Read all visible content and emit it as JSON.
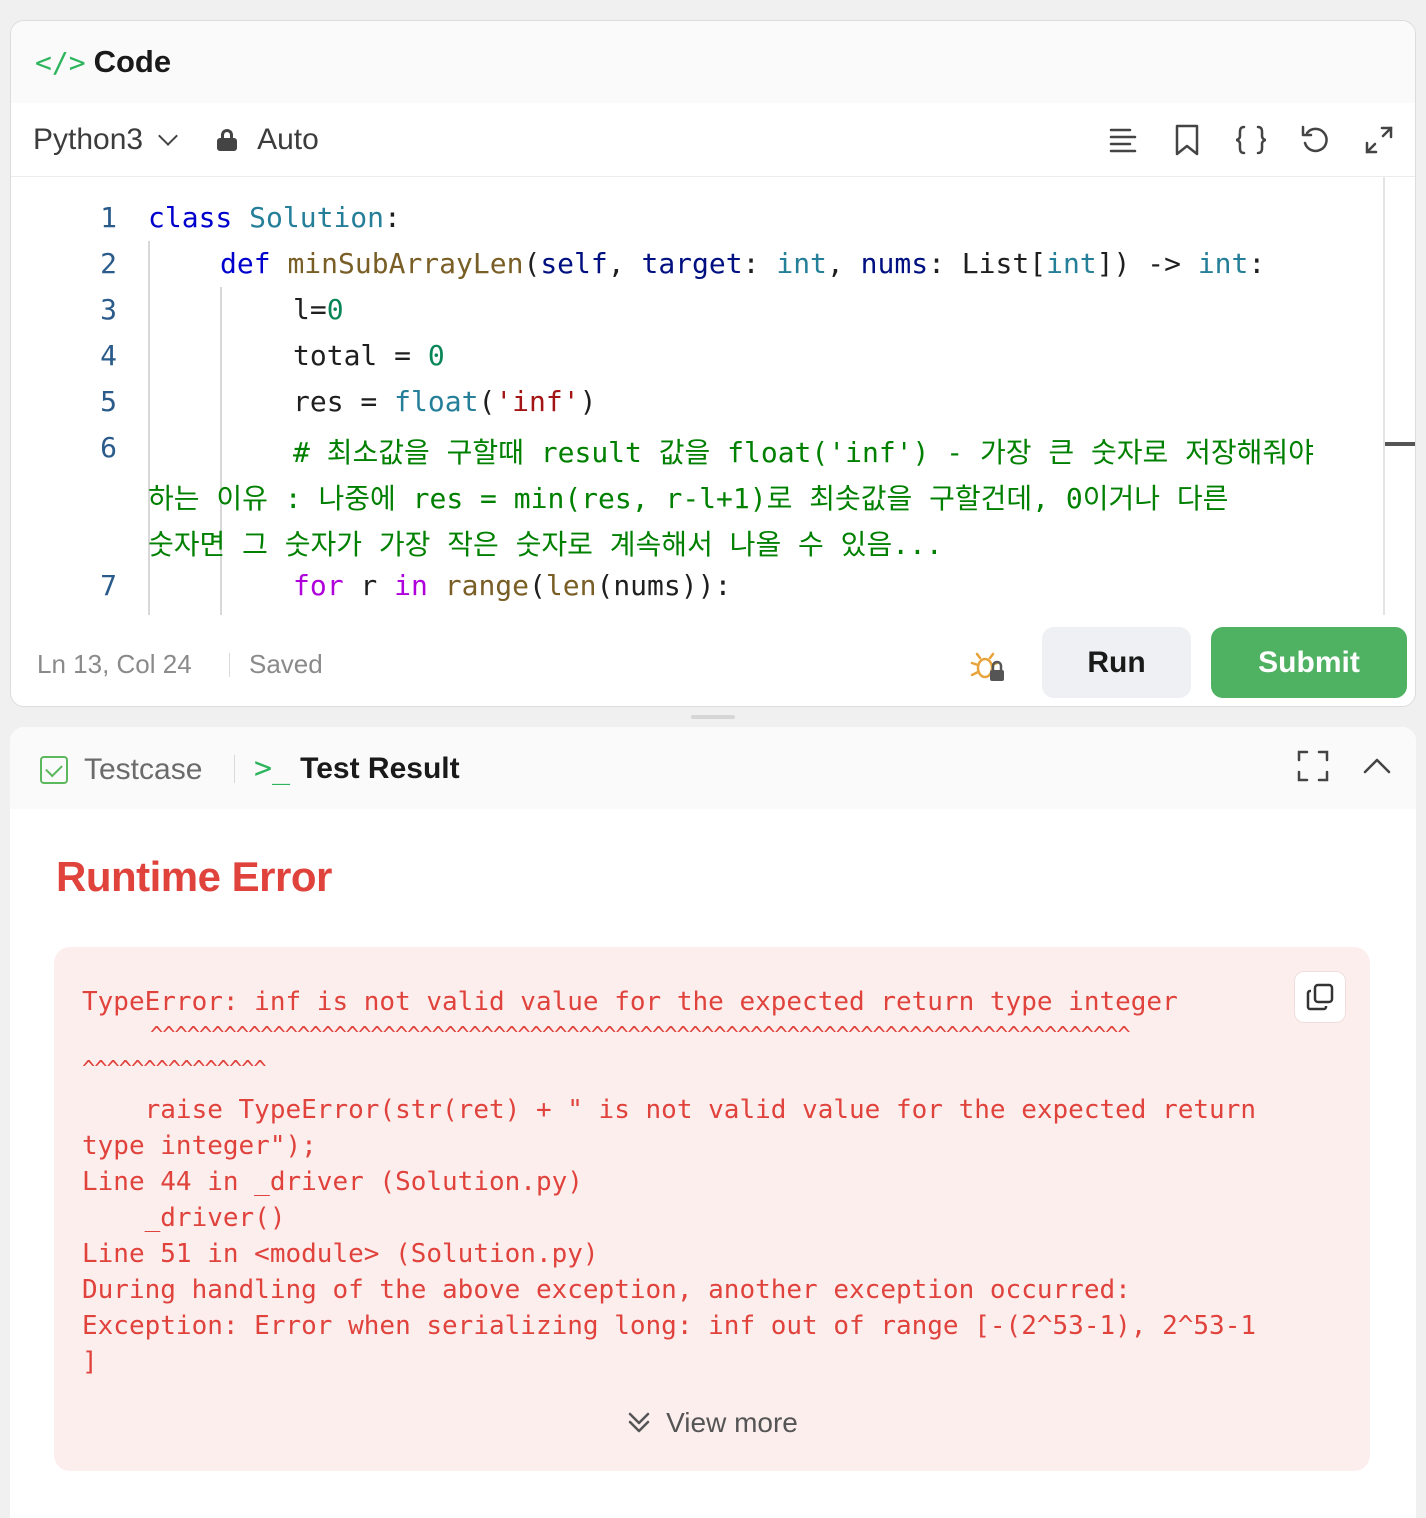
{
  "code_panel": {
    "title": "Code",
    "language": "Python3",
    "mode": "Auto",
    "toolbar_icons": [
      "format-icon",
      "bookmark-icon",
      "braces-icon",
      "undo-icon",
      "expand-icon"
    ]
  },
  "editor": {
    "lines": [
      {
        "num": "1",
        "text": "class Solution:"
      },
      {
        "num": "2",
        "text": "def minSubArrayLen(self, target: int, nums: List[int]) -> int:"
      },
      {
        "num": "3",
        "text": "l=0"
      },
      {
        "num": "4",
        "text": "total = 0"
      },
      {
        "num": "5",
        "text": "res = float('inf')"
      },
      {
        "num": "6",
        "text": "# 최소값을 구할때 result 값을 float('inf') - 가장 큰 숫자로 저장해줘야",
        "wrap1": "하는 이유 : 나중에 res = min(res, r-l+1)로 최솟값을 구할건데, 0이거나 다른",
        "wrap2": "숫자면 그 숫자가 가장 작은 숫자로 계속해서 나올 수 있음..."
      },
      {
        "num": "7",
        "text": "for r in range(len(nums)):"
      }
    ]
  },
  "status": {
    "position": "Ln 13, Col 24",
    "saved": "Saved",
    "run_label": "Run",
    "submit_label": "Submit"
  },
  "result_panel": {
    "tab_testcase": "Testcase",
    "tab_result": "Test Result",
    "error_title": "Runtime Error",
    "error_lines": [
      "TypeError: inf is not valid value for the expected return type integer",
      "    raise TypeError(str(ret) + \" is not valid value for the expected return",
      "type integer\");",
      "Line 44 in _driver (Solution.py)",
      "    _driver()",
      "Line 51 in <module> (Solution.py)",
      "During handling of the above exception, another exception occurred:",
      "Exception: Error when serializing long: inf out of range [-(2^53-1), 2^53-1",
      "]"
    ],
    "caret_line_1": "^^^^^^^^^^^^^^^^^^^^^^^^^^^^^^^^^^^^^^^^^^^^^^^^^^^^^^^^^^^^^^^^^^^^^^^^^^^^^^^^",
    "caret_line_2": "^^^^^^^^^^^^^^^",
    "view_more": "View more"
  },
  "colors": {
    "accent_green": "#2db55d",
    "submit_green": "#4fb162",
    "error_red": "#e0423c",
    "error_bg": "#fdeeee"
  }
}
